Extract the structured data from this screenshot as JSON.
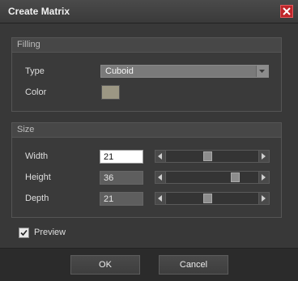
{
  "window": {
    "title": "Create Matrix",
    "close_icon": "close-icon"
  },
  "filling": {
    "header": "Filling",
    "type_label": "Type",
    "type_value": "Cuboid",
    "color_label": "Color",
    "color_value": "#9c9784"
  },
  "size": {
    "header": "Size",
    "rows": [
      {
        "label": "Width",
        "value": "21",
        "slider_fraction": 0.45
      },
      {
        "label": "Height",
        "value": "36",
        "slider_fraction": 0.78
      },
      {
        "label": "Depth",
        "value": "21",
        "slider_fraction": 0.45
      }
    ]
  },
  "preview": {
    "label": "Preview",
    "checked": true
  },
  "buttons": {
    "ok": "OK",
    "cancel": "Cancel"
  }
}
